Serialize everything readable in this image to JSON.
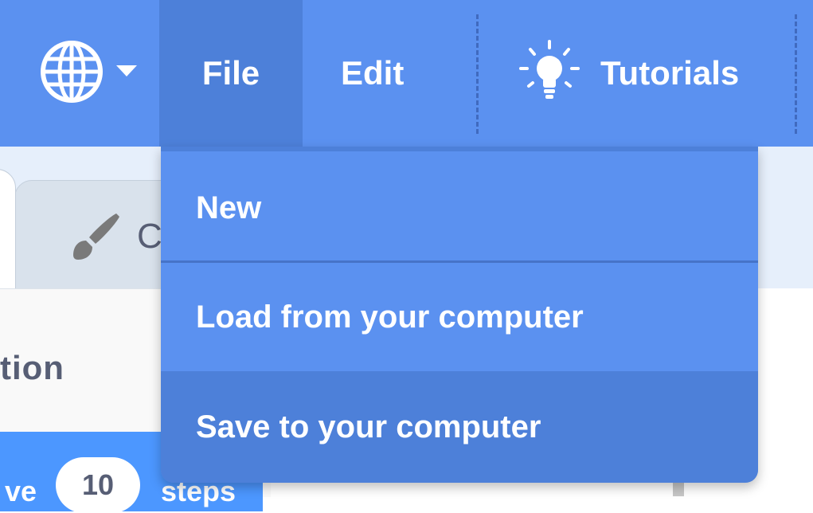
{
  "menubar": {
    "language_icon": "globe-icon",
    "language_caret": "caret-down-icon",
    "items": [
      {
        "label": "File",
        "active": true
      },
      {
        "label": "Edit"
      },
      {
        "label": "Tutorials",
        "icon": "lightbulb-icon"
      }
    ]
  },
  "file_menu": {
    "items": [
      {
        "label": "New"
      },
      {
        "label": "Load from your computer"
      },
      {
        "label": "Save to your computer",
        "highlighted": true
      }
    ]
  },
  "background": {
    "tab_icon": "paintbrush-icon",
    "tab_label_partial": "C",
    "category_title_partial": "tion",
    "block": {
      "word1": "ve",
      "value": "10",
      "word2": "steps"
    }
  },
  "colors": {
    "menu_blue": "#5b91f0",
    "menu_active_blue": "#4d80d9",
    "block_blue": "#4c97ff",
    "text_gray": "#575e75"
  }
}
